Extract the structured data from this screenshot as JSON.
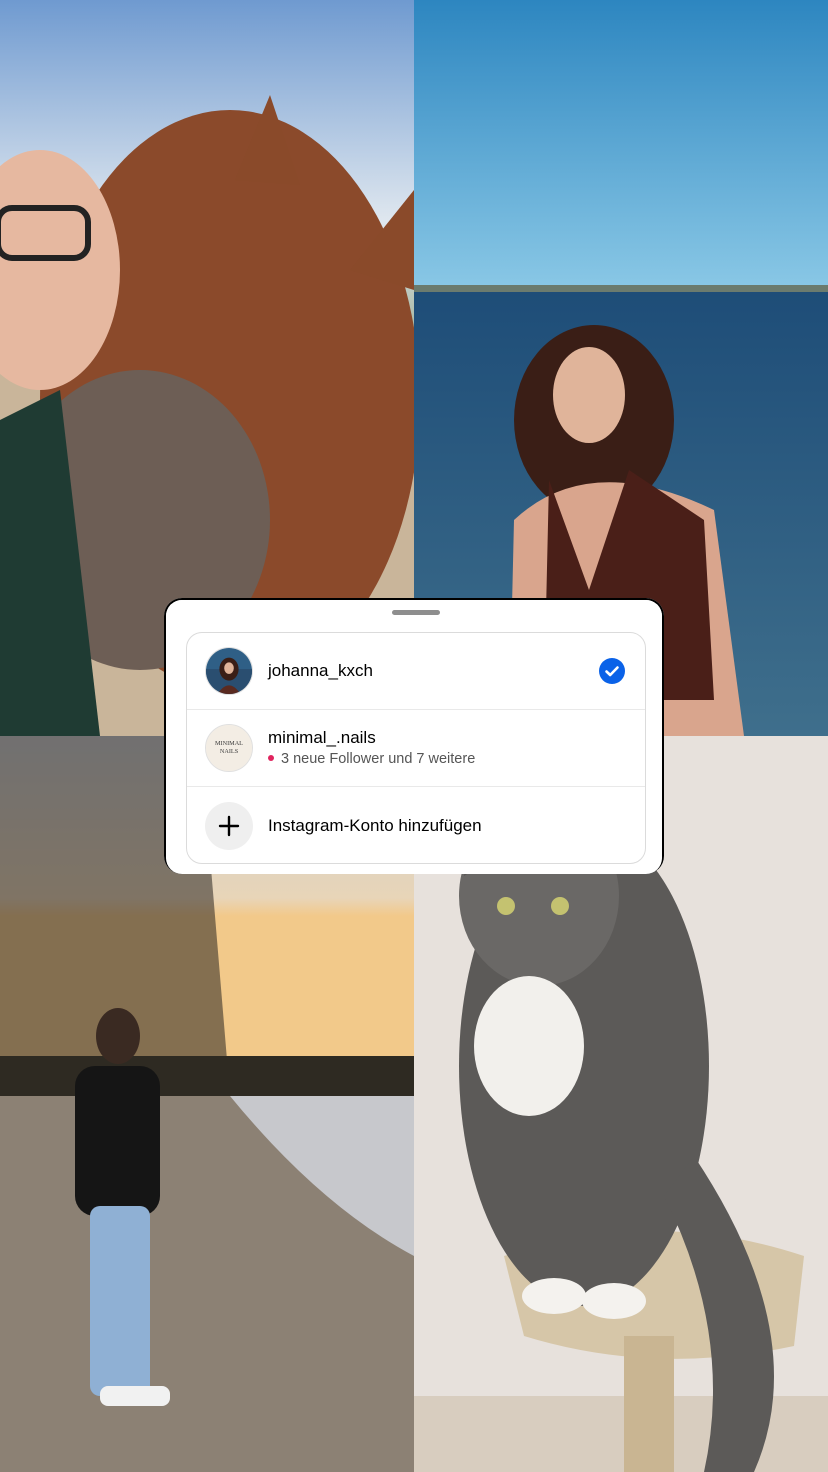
{
  "accounts": [
    {
      "username": "johanna_kxch",
      "selected": true,
      "avatar_icon": "profile-photo"
    },
    {
      "username": "minimal_.nails",
      "notification": "3 neue Follower und 7 weitere",
      "avatar_text": [
        "MINIMAL",
        "NAILS"
      ]
    }
  ],
  "add_account": {
    "label": "Instagram-Konto hinzufügen",
    "icon": "plus-icon"
  },
  "colors": {
    "accent": "#0a62e8",
    "notification_dot": "#e0245e"
  }
}
